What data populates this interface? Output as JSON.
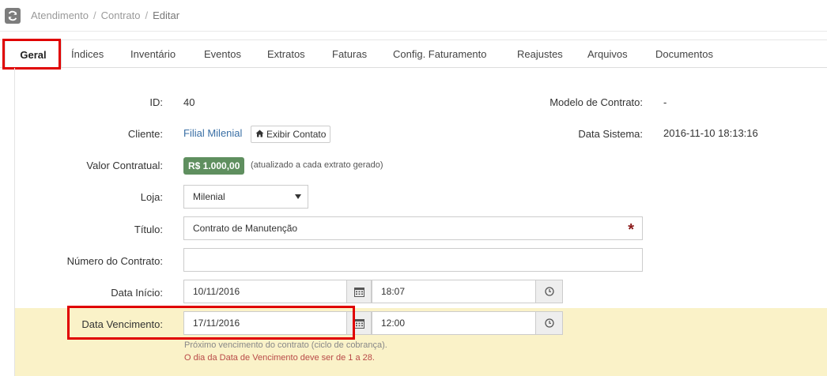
{
  "breadcrumb": {
    "items": [
      "Atendimento",
      "Contrato",
      "Editar"
    ]
  },
  "tabs": [
    {
      "label": "Geral",
      "active": true
    },
    {
      "label": "Índices"
    },
    {
      "label": "Inventário"
    },
    {
      "label": "Eventos"
    },
    {
      "label": "Extratos"
    },
    {
      "label": "Faturas"
    },
    {
      "label": "Config. Faturamento"
    },
    {
      "label": "Reajustes"
    },
    {
      "label": "Arquivos"
    },
    {
      "label": "Documentos"
    }
  ],
  "form": {
    "id": {
      "label": "ID:",
      "value": "40"
    },
    "modelo": {
      "label": "Modelo de Contrato:",
      "value": "-"
    },
    "cliente": {
      "label": "Cliente:",
      "value": "Filial Milenial",
      "button": "Exibir Contato"
    },
    "data_sistema": {
      "label": "Data Sistema:",
      "value": "2016-11-10 18:13:16"
    },
    "valor": {
      "label": "Valor Contratual:",
      "value": "R$ 1.000,00",
      "hint": "(atualizado a cada extrato gerado)"
    },
    "loja": {
      "label": "Loja:",
      "value": "Milenial"
    },
    "titulo": {
      "label": "Título:",
      "value": "Contrato de Manutenção",
      "required_mark": "*"
    },
    "numero": {
      "label": "Número do Contrato:",
      "value": ""
    },
    "data_inicio": {
      "label": "Data Início:",
      "date": "10/11/2016",
      "time": "18:07"
    },
    "data_vencimento": {
      "label": "Data Vencimento:",
      "date": "17/11/2016",
      "time": "12:00",
      "help": "Próximo vencimento do contrato (ciclo de cobrança).",
      "error": "O dia da Data de Vencimento deve ser de 1 a 28."
    }
  },
  "icons": {
    "refresh": "refresh-icon",
    "home": "home-icon",
    "calendar": "calendar-icon",
    "clock": "clock-icon"
  },
  "colors": {
    "badge": "#5f8f5f",
    "highlight_band": "#faf2c8",
    "annotation_red": "#e00000",
    "error_text": "#b94a48",
    "link": "#3a6fa5"
  }
}
